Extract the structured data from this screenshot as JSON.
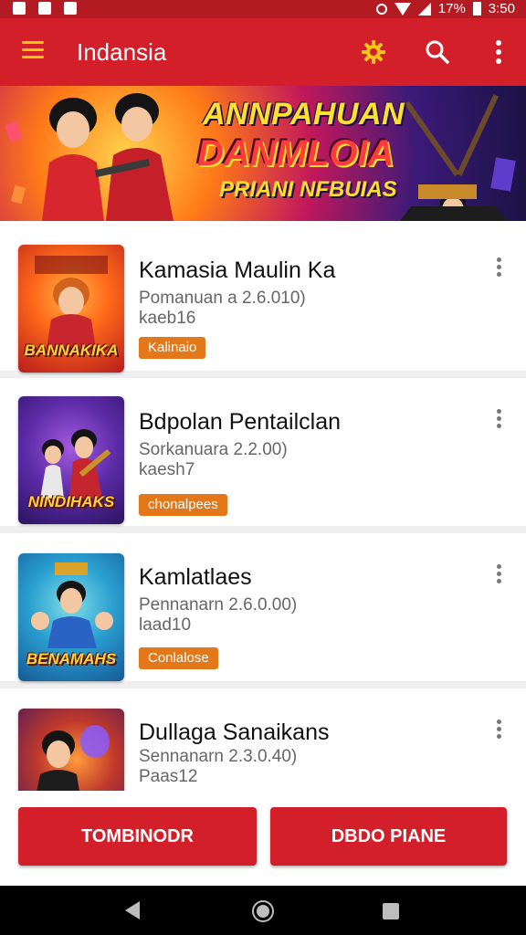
{
  "status_bar": {
    "battery": "17%",
    "time": "3:50",
    "icons": [
      "image-icon",
      "notification-icon",
      "notification-icon",
      "alarm-icon",
      "wifi-icon",
      "signal-icon",
      "battery-icon"
    ]
  },
  "app_bar": {
    "title": "Indansia",
    "icons": [
      "menu-icon",
      "gear-icon",
      "search-icon",
      "more-vert-icon"
    ],
    "accent_color": "#d21f2a",
    "icon_color": "#f5c518"
  },
  "banner": {
    "line1": "ANNPAHUAN",
    "line2": "DANMLOIA",
    "line3": "PRIANI NFBUIAS"
  },
  "games": [
    {
      "name": "Kamasia Maulin Ka",
      "detail": "Pomanuan a 2.6.010)",
      "meta": "kaeb16",
      "tag": "Kalinaio",
      "thumb_title": "BANNAKIKA"
    },
    {
      "name": "Bdpolan Pentailclan",
      "detail": "Sorkanuara 2.2.00)",
      "meta": "kaesh7",
      "tag": "chonalpees",
      "thumb_title": "NINDIHAKS"
    },
    {
      "name": "Kamlatlaes",
      "detail": "Pennanarn 2.6.0.00)",
      "meta": "laad10",
      "tag": "Conlalose",
      "thumb_title": "BENAMAHS"
    },
    {
      "name": "Dullaga Sanaikans",
      "detail": "Sennanarn 2.3.0.40)",
      "meta": "Paas12",
      "tag": "",
      "thumb_title": ""
    }
  ],
  "buttons": {
    "left": "TOMBINODR",
    "right": "DBDO PIANE"
  },
  "nav": {
    "icons": [
      "back-icon",
      "home-icon",
      "recents-icon"
    ]
  }
}
